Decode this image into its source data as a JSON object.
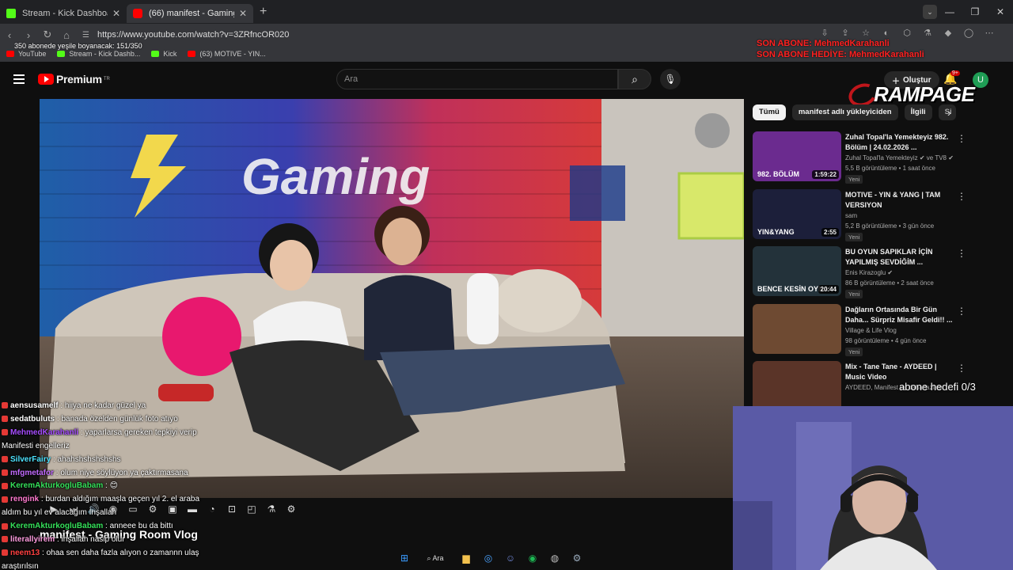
{
  "browser": {
    "tabs": [
      {
        "title": "Stream - Kick Dashboard",
        "close": "✕"
      },
      {
        "title": "(66) manifest - Gaming Room Vlog",
        "close": "✕"
      }
    ],
    "new_tab": "+",
    "url": "https://www.youtube.com/watch?v=3ZRfncOR020",
    "bookmarks": [
      {
        "label": "YouTube"
      },
      {
        "label": "Stream - Kick Dashb..."
      },
      {
        "label": "Kick"
      },
      {
        "label": "(63) MOTIVE - YIN..."
      }
    ]
  },
  "overlays": {
    "goal_text": "350 abonede yeşile boyanacak: 151/350",
    "last_sub": "SON ABONE: MehmedKarahanli",
    "last_gift": "SON ABONE HEDİYE: MehmedKarahanli",
    "sub_goal": "abone hedefi 0/3",
    "brand": "RAMPAGE"
  },
  "youtube": {
    "logo_text": "Premium",
    "logo_sup": "TR",
    "search_placeholder": "Ara",
    "create_label": "Oluştur",
    "bell_badge": "9+",
    "avatar_letter": "U",
    "video_title": "manifest - Gaming Room Vlog",
    "video_brand": "Gaming",
    "chips": [
      "Tümü",
      "manifest adlı yükleyiciden",
      "İlgili",
      "Si"
    ],
    "recommendations": [
      {
        "title": "Zuhal Topal'la Yemekteyiz 982. Bölüm | 24.02.2026 ...",
        "channel": "Zuhal Topal'la Yemekteyiz ✔ ve TV8 ✔",
        "meta": "5,5 B görüntüleme • 1 saat önce",
        "tag": "Yeni",
        "duration": "1:59:22",
        "thumb_text": "982. BÖLÜM",
        "color": "#6b2b8f"
      },
      {
        "title": "MOTIVE - YIN & YANG | TAM VERSIYON",
        "channel": "sam",
        "meta": "5,2 B görüntüleme • 3 gün önce",
        "tag": "Yeni",
        "duration": "2:55",
        "thumb_text": "YIN&YANG",
        "color": "#1c1f3a"
      },
      {
        "title": "BU OYUN SAPIKLAR İÇİN YAPILMIŞ SEVDİĞİM ...",
        "channel": "Enis Kirazoglu ✔",
        "meta": "86 B görüntüleme • 2 saat önce",
        "tag": "Yeni",
        "duration": "20:44",
        "thumb_text": "BENCE KESİN OYNA!",
        "color": "#23323a"
      },
      {
        "title": "Dağların Ortasında Bir Gün Daha... Sürpriz Misafir Geldi!! ...",
        "channel": "Village & Life Vlog",
        "meta": "98 görüntüleme • 4 gün önce",
        "tag": "Yeni",
        "duration": "",
        "thumb_text": "",
        "color": "#6e4a32"
      },
      {
        "title": "Mix - Tane Tane - AYDEED | Music Video",
        "channel": "AYDEED, Manifest ve daha fazlası",
        "meta": "",
        "tag": "",
        "duration": "",
        "thumb_text": "",
        "color": "#5a3428"
      }
    ]
  },
  "chat": [
    {
      "user": "aensusamelf",
      "msg": ": hiiya ne kadar güzel ya",
      "color": "#ffffff"
    },
    {
      "user": "sedatbuluts",
      "msg": ": banada özelden günlük foto atıyo",
      "color": "#ffffff"
    },
    {
      "user": "MehmedKarahanli",
      "msg": ": yaparlarsa gereken tepkiyi verip",
      "color": "#a64dff"
    },
    {
      "user": "",
      "msg": "Manifesti engelleriz",
      "color": "#ffffff"
    },
    {
      "user": "SilverFairy",
      "msg": ": ahahshshshshshs",
      "color": "#4de3ff"
    },
    {
      "user": "mfgmetafor",
      "msg": ": olum niye söylüyon ya çaktırmasana",
      "color": "#c26bff"
    },
    {
      "user": "KeremAkturkogluBabam",
      "msg": ": 😊",
      "color": "#35e05a"
    },
    {
      "user": "rengink",
      "msg": ": burdan aldığım maaşla geçen yıl 2. el araba",
      "color": "#ff7ad0"
    },
    {
      "user": "",
      "msg": "aldım bu yıl ev alacağım İnşallah",
      "color": "#ffffff"
    },
    {
      "user": "KeremAkturkogluBabam",
      "msg": ": anneee bu da bittı",
      "color": "#35e05a"
    },
    {
      "user": "literallyirem",
      "msg": ": inşallah nasip olur",
      "color": "#ff9de0"
    },
    {
      "user": "neem13",
      "msg": ": ohaa sen daha fazla alıyon o zamannn ulaş",
      "color": "#ff4040"
    },
    {
      "user": "",
      "msg": "araştırılsın",
      "color": "#ffffff"
    }
  ],
  "taskbar": {
    "search_label": "Ara"
  }
}
